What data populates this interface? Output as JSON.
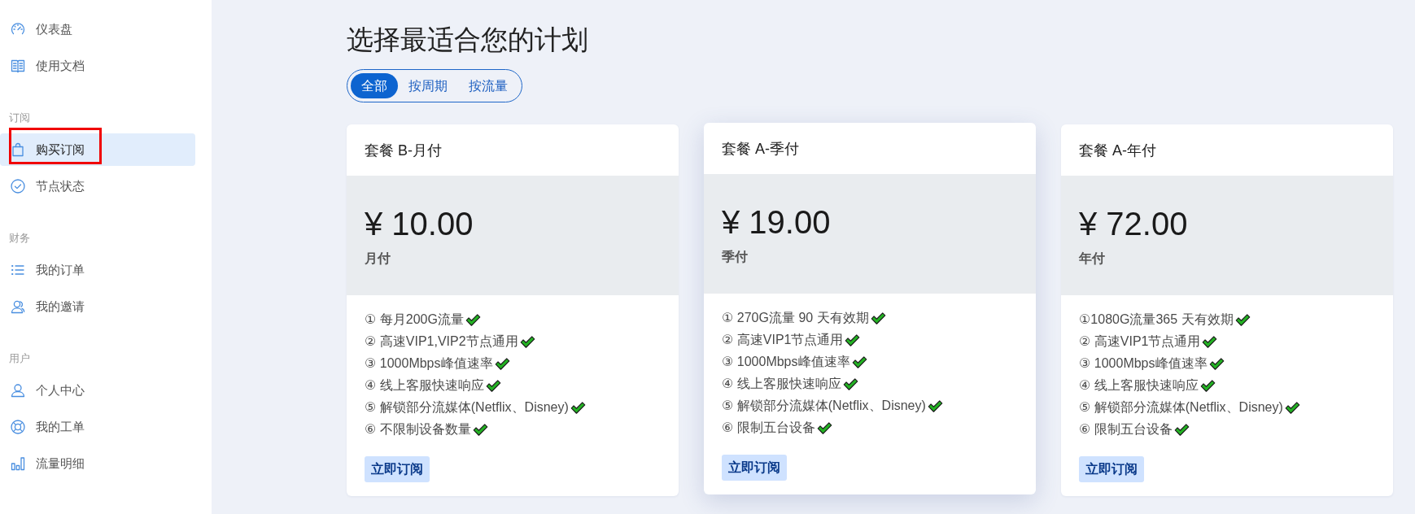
{
  "sidebar": {
    "sections": [
      {
        "items": [
          {
            "label": "仪表盘",
            "selected": false,
            "highlighted": false
          },
          {
            "label": "使用文档",
            "selected": false,
            "highlighted": false
          }
        ]
      },
      {
        "title": "订阅",
        "items": [
          {
            "label": "购买订阅",
            "selected": true,
            "highlighted": true
          },
          {
            "label": "节点状态",
            "selected": false,
            "highlighted": false
          }
        ]
      },
      {
        "title": "财务",
        "items": [
          {
            "label": "我的订单",
            "selected": false,
            "highlighted": false
          },
          {
            "label": "我的邀请",
            "selected": false,
            "highlighted": false
          }
        ]
      },
      {
        "title": "用户",
        "items": [
          {
            "label": "个人中心",
            "selected": false,
            "highlighted": false
          },
          {
            "label": "我的工单",
            "selected": false,
            "highlighted": false
          },
          {
            "label": "流量明细",
            "selected": false,
            "highlighted": false
          }
        ]
      }
    ]
  },
  "main": {
    "title": "选择最适合您的计划",
    "filter_tabs": [
      {
        "label": "全部",
        "selected": true
      },
      {
        "label": "按周期",
        "selected": false
      },
      {
        "label": "按流量",
        "selected": false
      }
    ],
    "plans": [
      {
        "name": "套餐 B-月付",
        "price": "¥ 10.00",
        "period": "月付",
        "elevated": false,
        "features": [
          "① 每月200G流量",
          "② 高速VIP1,VIP2节点通用",
          "③ 1000Mbps峰值速率",
          "④ 线上客服快速响应",
          "⑤ 解锁部分流媒体(Netflix、Disney)",
          "⑥ 不限制设备数量"
        ],
        "button": "立即订阅"
      },
      {
        "name": "套餐 A-季付",
        "price": "¥ 19.00",
        "period": "季付",
        "elevated": true,
        "features": [
          "① 270G流量 90 天有效期",
          "② 高速VIP1节点通用",
          "③ 1000Mbps峰值速率",
          "④ 线上客服快速响应",
          "⑤ 解锁部分流媒体(Netflix、Disney)",
          "⑥ 限制五台设备"
        ],
        "button": "立即订阅"
      },
      {
        "name": "套餐 A-年付",
        "price": "¥ 72.00",
        "period": "年付",
        "elevated": false,
        "features": [
          "①1080G流量365 天有效期",
          "② 高速VIP1节点通用",
          "③ 1000Mbps峰值速率",
          "④ 线上客服快速响应",
          "⑤ 解锁部分流媒体(Netflix、Disney)",
          "⑥ 限制五台设备"
        ],
        "button": "立即订阅"
      }
    ]
  }
}
